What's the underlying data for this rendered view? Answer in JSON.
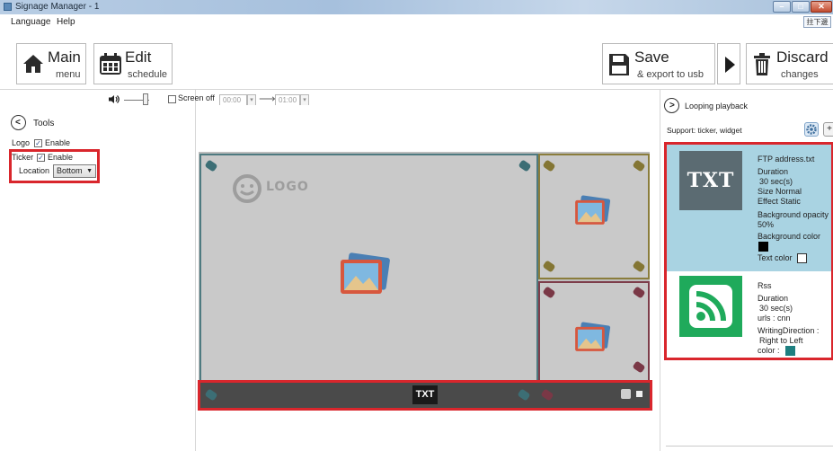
{
  "window": {
    "title": "Signage Manager - 1",
    "ime_badge": "拄下邊"
  },
  "menu": {
    "items": [
      {
        "label": "Language"
      },
      {
        "label": "Help"
      }
    ]
  },
  "toolbar": {
    "main": {
      "title": "Main",
      "subtitle": "menu",
      "icon": "home-icon"
    },
    "edit": {
      "title": "Edit",
      "subtitle": "schedule",
      "icon": "calendar-icon"
    },
    "save": {
      "title": "Save",
      "subtitle": "& export to usb",
      "icon": "floppy-disk-icon"
    },
    "play": {
      "icon": "play-icon"
    },
    "discard": {
      "title": "Discard",
      "subtitle": "changes",
      "icon": "trash-icon"
    }
  },
  "tools": {
    "label": "Tools",
    "logo": {
      "label": "Logo",
      "enable_label": "Enable",
      "enabled": true
    },
    "ticker": {
      "label": "Ticker",
      "enable_label": "Enable",
      "enabled": true
    },
    "location": {
      "label": "Location",
      "value": "Bottom"
    }
  },
  "preview_bar": {
    "volume_icon": "speaker-icon",
    "screen_off_label": "Screen off",
    "screen_off_checked": false,
    "time_from": "00:00",
    "time_to": "01:00"
  },
  "canvas": {
    "logo_text": "LOGO",
    "ticker_badge": "TXT"
  },
  "right_panel": {
    "header": "Looping playback",
    "support": "Support:  ticker, widget",
    "items": [
      {
        "thumb": "TXT",
        "name": "FTP address.txt",
        "duration_label": "Duration",
        "duration_value": "30  sec(s)",
        "size": "Size  Normal",
        "effect": "Effect  Static",
        "bg_opacity_label": "Background opacity",
        "bg_opacity_value": "50%",
        "bg_color_label": "Background color",
        "bg_color": "#000000",
        "text_color_label": "Text color",
        "text_color": "#ffffff"
      },
      {
        "thumb": "rss-icon",
        "name": "Rss",
        "duration_label": "Duration",
        "duration_value": "30  sec(s)",
        "urls": "urls :  cnn",
        "direction_label": "WritingDirection :",
        "direction_value": "Right to Left",
        "color_label": "color :",
        "color": "#1e7f80"
      }
    ]
  },
  "colors": {
    "highlight_red": "#d9262c",
    "selected_item_bg": "#a9d3e2",
    "rss_green": "#1faa5b"
  }
}
